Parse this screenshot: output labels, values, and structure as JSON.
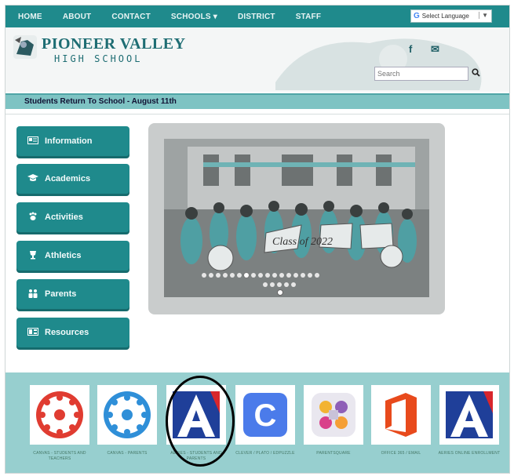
{
  "topnav": {
    "items": [
      "HOME",
      "ABOUT",
      "CONTACT",
      "SCHOOLS ▾",
      "DISTRICT",
      "STAFF"
    ],
    "language_select": "Select Language"
  },
  "header": {
    "school_name": "PIONEER VALLEY",
    "school_sub": "HIGH SCHOOL",
    "search_placeholder": "Search",
    "facebook_glyph": "f",
    "mail_glyph": "✉"
  },
  "announcement": "Students Return To School - August 11th",
  "sidebar": {
    "items": [
      {
        "label": "Information",
        "icon": "id-card-icon"
      },
      {
        "label": "Academics",
        "icon": "graduation-cap-icon"
      },
      {
        "label": "Activities",
        "icon": "paw-icon"
      },
      {
        "label": "Athletics",
        "icon": "trophy-icon"
      },
      {
        "label": "Parents",
        "icon": "family-icon"
      },
      {
        "label": "Resources",
        "icon": "resources-icon"
      }
    ]
  },
  "carousel": {
    "slide_count": 22,
    "active_slide": 6,
    "photo_text": "Class of 2022"
  },
  "apps": [
    {
      "name": "canvas-students-teachers",
      "label": "CANVAS - STUDENTS AND TEACHERS",
      "color": "#e03c31"
    },
    {
      "name": "canvas-parents",
      "label": "CANVAS - PARENTS",
      "color": "#2f8fd8"
    },
    {
      "name": "aeries-students-parents",
      "label": "AERIES - STUDENTS AND PARENTS",
      "color": "#1f3f99"
    },
    {
      "name": "clever",
      "label": "CLEVER / PLATO / EDPUZZLE",
      "color": "#4b7bea"
    },
    {
      "name": "parentsquare",
      "label": "PARENTSQUARE",
      "color": "#8e5fb7"
    },
    {
      "name": "office-365",
      "label": "OFFICE 365 / EMAIL",
      "color": "#e84a1c"
    },
    {
      "name": "aeries-enrollment",
      "label": "AERIES ONLINE ENROLLMENT",
      "color": "#1f3f99"
    }
  ]
}
